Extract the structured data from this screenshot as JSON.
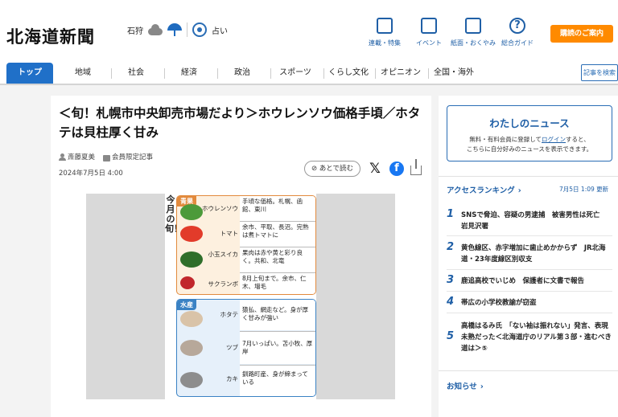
{
  "header": {
    "logo": "北海道新聞",
    "weather_location": "石狩",
    "fortune_label": "占い",
    "nav": [
      {
        "label": "連載・特集",
        "icon": "flag-icon"
      },
      {
        "label": "イベント",
        "icon": "calendar-icon"
      },
      {
        "label": "紙面・おくやみ",
        "icon": "newspaper-icon"
      },
      {
        "label": "総合ガイド",
        "icon": "help-icon"
      }
    ],
    "subscribe_label": "購読のご案内"
  },
  "nav": {
    "items": [
      "トップ",
      "地域",
      "社会",
      "経済",
      "政治",
      "スポーツ",
      "くらし文化",
      "オピニオン",
      "全国・海外"
    ],
    "search_label": "記事を検索"
  },
  "article": {
    "title": "＜旬！札幌市中央卸売市場だより＞ホウレンソウ価格手頃／ホタテは貝柱厚く甘み",
    "author": "斎藤夏美",
    "members_only": "会員限定記事",
    "date": "2024年7月5日 4:00",
    "read_later": "あとで読む",
    "figure": {
      "title": "今月の旬！",
      "fruit_tag": "青果",
      "fruit_rows": [
        {
          "name": "ホウレンソウ",
          "desc": "手頃な価格。札幌、函館、東川"
        },
        {
          "name": "トマト",
          "desc": "余市、平取、長沼。完熟は煮トマトに"
        },
        {
          "name": "小玉スイカ",
          "desc": "果肉は赤や黄と彩り良く。共和、北竜"
        },
        {
          "name": "サクランボ",
          "desc": "8月上旬まで。余市、仁木、増毛"
        }
      ],
      "sea_tag": "水産",
      "sea_rows": [
        {
          "name": "ホタテ",
          "desc": "猿払、網走など。身が厚く甘みが強い"
        },
        {
          "name": "ツブ",
          "desc": "7月いっぱい。苫小牧、厚岸"
        },
        {
          "name": "カキ",
          "desc": "釧路町産、身が締まっている"
        }
      ]
    }
  },
  "sidebar": {
    "mynews_title": "わたしのニュース",
    "mynews_desc_1": "無料・有料会員に登録して",
    "mynews_login": "ログイン",
    "mynews_desc_2": "すると、",
    "mynews_desc_3": "こちらに自分好みのニュースを表示できます。",
    "ranking_title": "アクセスランキング",
    "ranking_date": "7月5日 1:09 更新",
    "ranking": [
      {
        "rank": "1",
        "text": "SNSで脅迫、容疑の男逮捕　被害男性は死亡　岩見沢署"
      },
      {
        "rank": "2",
        "text": "黄色線区、赤字増加に歯止めかからず　JR北海道・23年度線区別収支"
      },
      {
        "rank": "3",
        "text": "鹿追高校でいじめ　保護者に文書で報告"
      },
      {
        "rank": "4",
        "text": "帯広の小学校教諭が窃盗"
      },
      {
        "rank": "5",
        "text": "高橋はるみ氏　「ない袖は振れない」発言、表現未熟だった＜北海道庁のリアル第３部・進むべき道は＞⑤"
      }
    ],
    "notice_title": "お知らせ"
  }
}
